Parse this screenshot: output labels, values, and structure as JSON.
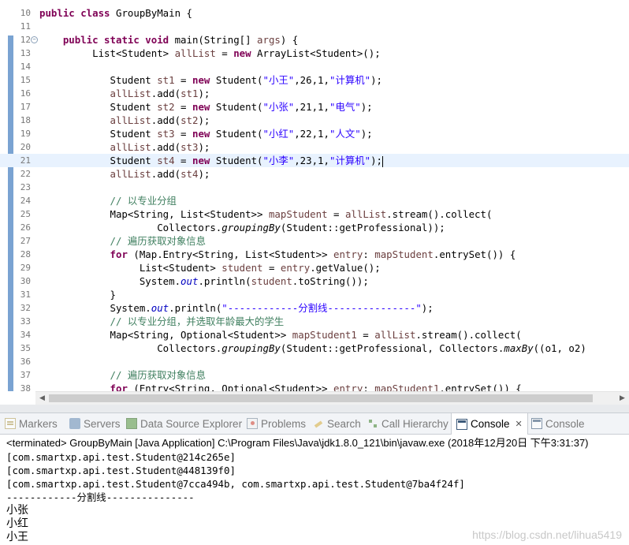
{
  "editor": {
    "lines": [
      {
        "num": "10",
        "segments": [
          {
            "t": "public class ",
            "c": "kw"
          },
          {
            "t": "GroupByMain {",
            "c": ""
          }
        ]
      },
      {
        "num": "11",
        "segments": []
      },
      {
        "num": "12",
        "fold": true,
        "segments": [
          {
            "t": "    "
          },
          {
            "t": "public static void ",
            "c": "kw"
          },
          {
            "t": "main(String[] "
          },
          {
            "t": "args",
            "c": "var"
          },
          {
            "t": ") {"
          }
        ]
      },
      {
        "num": "13",
        "segments": [
          {
            "t": "         List<Student> "
          },
          {
            "t": "allList",
            "c": "var"
          },
          {
            "t": " = "
          },
          {
            "t": "new ",
            "c": "kw"
          },
          {
            "t": "ArrayList<Student>();"
          }
        ]
      },
      {
        "num": "14",
        "segments": []
      },
      {
        "num": "15",
        "segments": [
          {
            "t": "            Student "
          },
          {
            "t": "st1",
            "c": "var"
          },
          {
            "t": " = "
          },
          {
            "t": "new ",
            "c": "kw"
          },
          {
            "t": "Student("
          },
          {
            "t": "\"小王\"",
            "c": "str"
          },
          {
            "t": ",26,1,"
          },
          {
            "t": "\"计算机\"",
            "c": "str"
          },
          {
            "t": ");"
          }
        ]
      },
      {
        "num": "16",
        "segments": [
          {
            "t": "            "
          },
          {
            "t": "allList",
            "c": "var"
          },
          {
            "t": ".add("
          },
          {
            "t": "st1",
            "c": "var"
          },
          {
            "t": ");"
          }
        ]
      },
      {
        "num": "17",
        "segments": [
          {
            "t": "            Student "
          },
          {
            "t": "st2",
            "c": "var"
          },
          {
            "t": " = "
          },
          {
            "t": "new ",
            "c": "kw"
          },
          {
            "t": "Student("
          },
          {
            "t": "\"小张\"",
            "c": "str"
          },
          {
            "t": ",21,1,"
          },
          {
            "t": "\"电气\"",
            "c": "str"
          },
          {
            "t": ");"
          }
        ]
      },
      {
        "num": "18",
        "segments": [
          {
            "t": "            "
          },
          {
            "t": "allList",
            "c": "var"
          },
          {
            "t": ".add("
          },
          {
            "t": "st2",
            "c": "var"
          },
          {
            "t": ");"
          }
        ]
      },
      {
        "num": "19",
        "segments": [
          {
            "t": "            Student "
          },
          {
            "t": "st3",
            "c": "var"
          },
          {
            "t": " = "
          },
          {
            "t": "new ",
            "c": "kw"
          },
          {
            "t": "Student("
          },
          {
            "t": "\"小红\"",
            "c": "str"
          },
          {
            "t": ",22,1,"
          },
          {
            "t": "\"人文\"",
            "c": "str"
          },
          {
            "t": ");"
          }
        ]
      },
      {
        "num": "20",
        "segments": [
          {
            "t": "            "
          },
          {
            "t": "allList",
            "c": "var"
          },
          {
            "t": ".add("
          },
          {
            "t": "st3",
            "c": "var"
          },
          {
            "t": ");"
          }
        ]
      },
      {
        "num": "21",
        "highlight": true,
        "caret": true,
        "segments": [
          {
            "t": "            Student "
          },
          {
            "t": "st4",
            "c": "var"
          },
          {
            "t": " = "
          },
          {
            "t": "new ",
            "c": "kw"
          },
          {
            "t": "Student("
          },
          {
            "t": "\"小李\"",
            "c": "str"
          },
          {
            "t": ",23,1,"
          },
          {
            "t": "\"计算机\"",
            "c": "str"
          },
          {
            "t": ");"
          }
        ]
      },
      {
        "num": "22",
        "segments": [
          {
            "t": "            "
          },
          {
            "t": "allList",
            "c": "var"
          },
          {
            "t": ".add("
          },
          {
            "t": "st4",
            "c": "var"
          },
          {
            "t": ");"
          }
        ]
      },
      {
        "num": "23",
        "segments": []
      },
      {
        "num": "24",
        "segments": [
          {
            "t": "            "
          },
          {
            "t": "// 以专业分组",
            "c": "cm"
          }
        ]
      },
      {
        "num": "25",
        "segments": [
          {
            "t": "            Map<String, List<Student>> "
          },
          {
            "t": "mapStudent",
            "c": "var"
          },
          {
            "t": " = "
          },
          {
            "t": "allList",
            "c": "var"
          },
          {
            "t": ".stream().collect("
          }
        ]
      },
      {
        "num": "26",
        "segments": [
          {
            "t": "                    Collectors."
          },
          {
            "t": "groupingBy",
            "c": "mit"
          },
          {
            "t": "(Student::getProfessional));"
          }
        ]
      },
      {
        "num": "27",
        "segments": [
          {
            "t": "            "
          },
          {
            "t": "// 遍历获取对象信息",
            "c": "cm"
          }
        ]
      },
      {
        "num": "28",
        "segments": [
          {
            "t": "            "
          },
          {
            "t": "for ",
            "c": "kw"
          },
          {
            "t": "(Map.Entry<String, List<Student>> "
          },
          {
            "t": "entry",
            "c": "var"
          },
          {
            "t": ": "
          },
          {
            "t": "mapStudent",
            "c": "var"
          },
          {
            "t": ".entrySet()) {"
          }
        ]
      },
      {
        "num": "29",
        "segments": [
          {
            "t": "                 List<Student> "
          },
          {
            "t": "student",
            "c": "var"
          },
          {
            "t": " = "
          },
          {
            "t": "entry",
            "c": "var"
          },
          {
            "t": ".getValue();"
          }
        ]
      },
      {
        "num": "30",
        "segments": [
          {
            "t": "                 System."
          },
          {
            "t": "out",
            "c": "fld"
          },
          {
            "t": ".println("
          },
          {
            "t": "student",
            "c": "var"
          },
          {
            "t": ".toString());"
          }
        ]
      },
      {
        "num": "31",
        "segments": [
          {
            "t": "            }"
          }
        ]
      },
      {
        "num": "32",
        "segments": [
          {
            "t": "            System."
          },
          {
            "t": "out",
            "c": "fld"
          },
          {
            "t": ".println("
          },
          {
            "t": "\"------------分割线---------------\"",
            "c": "str"
          },
          {
            "t": ");"
          }
        ]
      },
      {
        "num": "33",
        "segments": [
          {
            "t": "            "
          },
          {
            "t": "// 以专业分组，并选取年龄最大的学生",
            "c": "cm"
          }
        ]
      },
      {
        "num": "34",
        "segments": [
          {
            "t": "            Map<String, Optional<Student>> "
          },
          {
            "t": "mapStudent1",
            "c": "var"
          },
          {
            "t": " = "
          },
          {
            "t": "allList",
            "c": "var"
          },
          {
            "t": ".stream().collect("
          }
        ]
      },
      {
        "num": "35",
        "segments": [
          {
            "t": "                    Collectors."
          },
          {
            "t": "groupingBy",
            "c": "mit"
          },
          {
            "t": "(Student::getProfessional, Collectors."
          },
          {
            "t": "maxBy",
            "c": "mit"
          },
          {
            "t": "((o1, o2)"
          }
        ]
      },
      {
        "num": "36",
        "segments": []
      },
      {
        "num": "37",
        "segments": [
          {
            "t": "            "
          },
          {
            "t": "// 遍历获取对象信息",
            "c": "cm"
          }
        ]
      },
      {
        "num": "38",
        "segments": [
          {
            "t": "            "
          },
          {
            "t": "for ",
            "c": "kw"
          },
          {
            "t": "(Entry<String, Optional<Student>> "
          },
          {
            "t": "entry",
            "c": "var"
          },
          {
            "t": ": "
          },
          {
            "t": "mapStudent1",
            "c": "var"
          },
          {
            "t": ".entrySet()) {"
          }
        ]
      }
    ]
  },
  "scrollbar": {
    "left_arrow": "◀",
    "right_arrow": "▶"
  },
  "tabs": [
    {
      "label": "Markers",
      "icon": "markers-icon",
      "active": false
    },
    {
      "label": "Servers",
      "icon": "servers-icon",
      "active": false
    },
    {
      "label": "Data Source Explorer",
      "icon": "data-source-icon",
      "active": false
    },
    {
      "label": "Problems",
      "icon": "problems-icon",
      "active": false
    },
    {
      "label": "Search",
      "icon": "search-icon",
      "active": false
    },
    {
      "label": "Call Hierarchy",
      "icon": "call-hierarchy-icon",
      "active": false
    },
    {
      "label": "Console",
      "icon": "console-icon",
      "active": true,
      "close": "✕"
    },
    {
      "label": "Console",
      "icon": "console-icon",
      "active": false
    }
  ],
  "console": {
    "status": "<terminated> GroupByMain [Java Application] C:\\Program Files\\Java\\jdk1.8.0_121\\bin\\javaw.exe (2018年12月20日 下午3:31:37)",
    "output": [
      "[com.smartxp.api.test.Student@214c265e]",
      "[com.smartxp.api.test.Student@448139f0]",
      "[com.smartxp.api.test.Student@7cca494b, com.smartxp.api.test.Student@7ba4f24f]",
      "------------分割线---------------",
      "小张",
      "小红",
      "小王"
    ],
    "watermark": "https://blog.csdn.net/lihua5419"
  },
  "colors": {
    "keyword": "#7f0055",
    "string": "#2a00ff",
    "comment": "#3f7f5f",
    "field": "#0000c0",
    "variable": "#6a3e3e",
    "gutter_bar": "#7aa3d2",
    "current_line": "#e8f2fe"
  }
}
